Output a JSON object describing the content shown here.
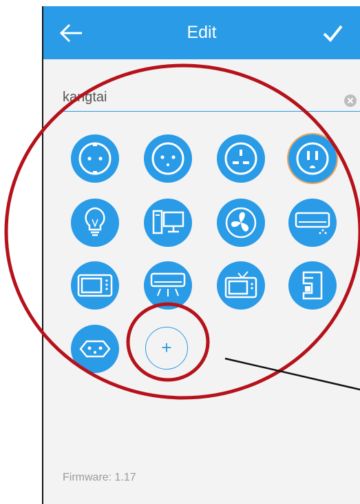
{
  "header": {
    "title": "Edit",
    "back_icon": "arrow-left-icon",
    "confirm_icon": "checkmark-icon"
  },
  "name_field": {
    "value": "kangtai"
  },
  "icons": [
    {
      "name": "schuko-socket-icon"
    },
    {
      "name": "europlug-socket-icon"
    },
    {
      "name": "uk-socket-icon"
    },
    {
      "name": "us-socket-icon",
      "selected": true
    },
    {
      "name": "light-bulb-icon"
    },
    {
      "name": "desktop-computer-icon"
    },
    {
      "name": "fan-icon"
    },
    {
      "name": "air-conditioner-icon"
    },
    {
      "name": "microwave-icon"
    },
    {
      "name": "ceiling-ac-icon"
    },
    {
      "name": "television-icon"
    },
    {
      "name": "coffee-machine-icon"
    },
    {
      "name": "swiss-socket-icon"
    }
  ],
  "add_button": {
    "label": "+"
  },
  "footer": {
    "firmware": "Firmware: 1.17"
  },
  "colors": {
    "appbar": "#2a9be6",
    "icon_bg": "#2a9be6",
    "selected_ring": "#f0a050",
    "annotation": "#b5121b"
  }
}
